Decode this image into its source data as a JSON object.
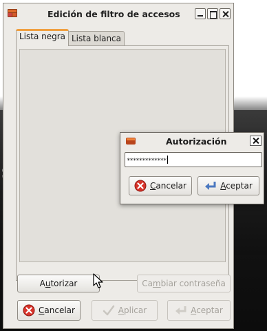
{
  "main_window": {
    "title": "Edición de filtro de accesos",
    "tabs": [
      {
        "label": "Lista negra",
        "active": true
      },
      {
        "label": "Lista blanca",
        "active": false
      }
    ],
    "buttons": {
      "authorize": {
        "pre": "A",
        "key": "u",
        "post": "torizar",
        "enabled": true
      },
      "change_password": {
        "pre": "Ca",
        "key": "m",
        "post": "biar contraseña",
        "enabled": false
      },
      "cancel": {
        "pre": "",
        "key": "C",
        "post": "ancelar",
        "enabled": true
      },
      "apply": {
        "pre": "",
        "key": "A",
        "post": "plicar",
        "enabled": false
      },
      "accept": {
        "pre": "",
        "key": "A",
        "post": "ceptar",
        "enabled": false
      }
    }
  },
  "auth_dialog": {
    "title": "Autorización",
    "password_value": "*************",
    "buttons": {
      "cancel": {
        "pre": "",
        "key": "C",
        "post": "ancelar"
      },
      "accept": {
        "pre": "",
        "key": "A",
        "post": "ceptar"
      }
    }
  },
  "desktop": {
    "partial_text": "s"
  },
  "icons": {
    "window_app": "firewall-icon",
    "cancel": "red-x-circle-icon",
    "apply": "checkmark-icon",
    "accept": "return-arrow-icon",
    "cursor": "mouse-pointer-icon"
  },
  "colors": {
    "tab_accent": "#f0a040",
    "cancel_icon": "#d8332a",
    "accept_icon": "#4a78c0"
  }
}
